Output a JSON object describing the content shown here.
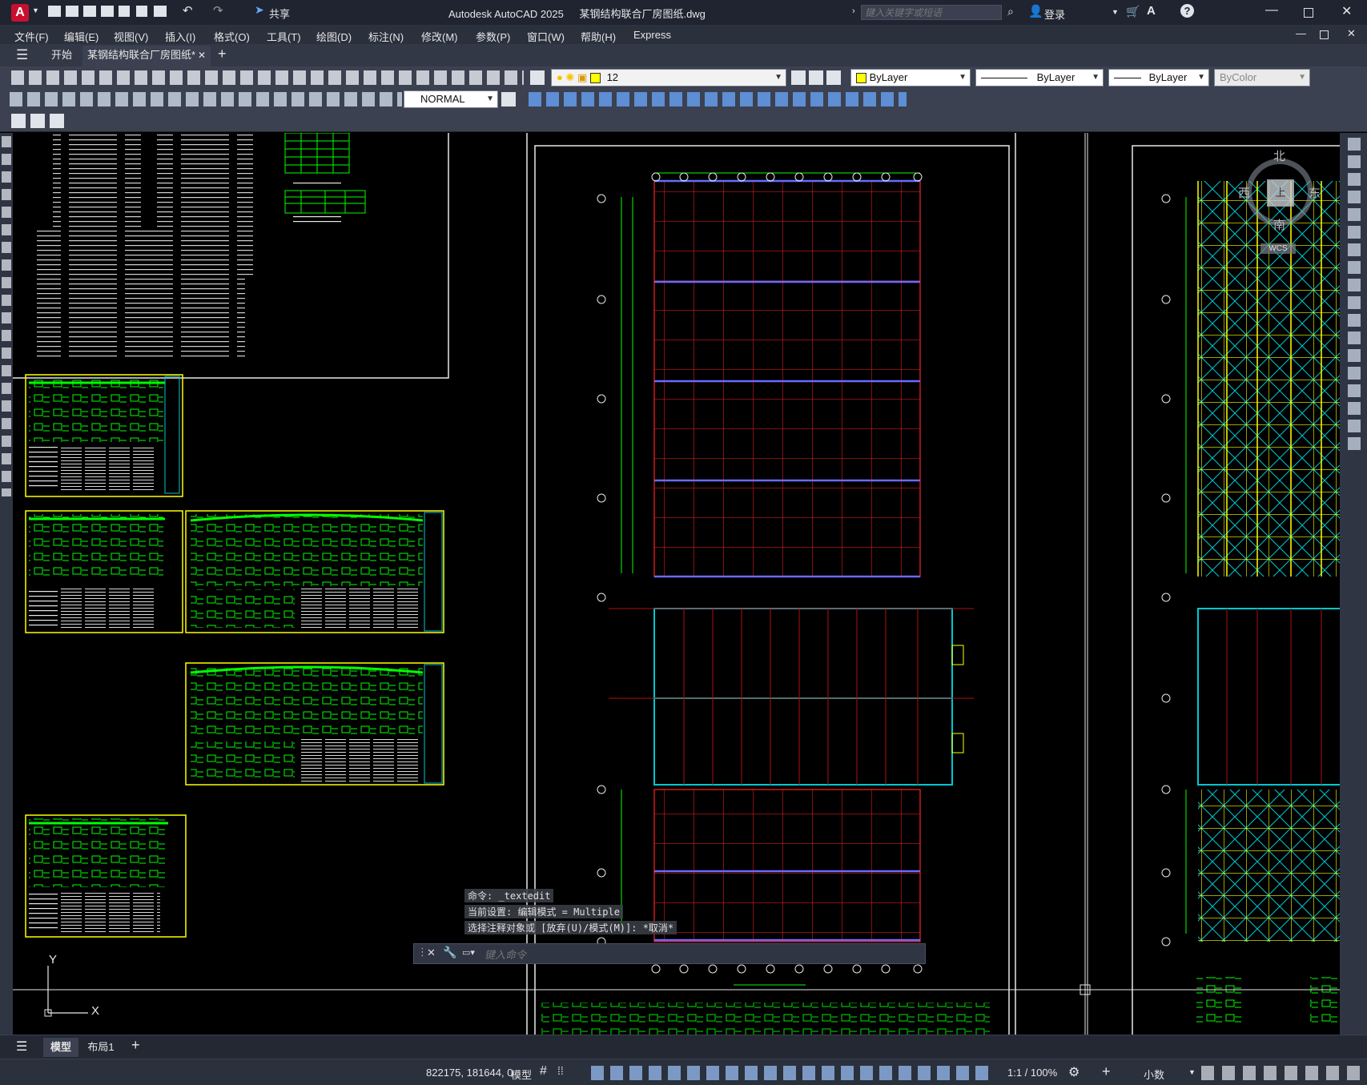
{
  "title_bar": {
    "app_title": "Autodesk AutoCAD 2025",
    "file_name": "某钢结构联合厂房图纸.dwg",
    "share_label": "共享",
    "search_placeholder": "键入关键字或短语",
    "login_label": "登录"
  },
  "menu": {
    "items": [
      "文件(F)",
      "编辑(E)",
      "视图(V)",
      "插入(I)",
      "格式(O)",
      "工具(T)",
      "绘图(D)",
      "标注(N)",
      "修改(M)",
      "参数(P)",
      "窗口(W)",
      "帮助(H)",
      "Express"
    ]
  },
  "doc_tabs": {
    "start_label": "开始",
    "active_label": "某钢结构联合厂房图纸*"
  },
  "toolbar": {
    "layer_value": "12",
    "color_value": "ByLayer",
    "linetype_value": "ByLayer",
    "lineweight_value": "ByLayer",
    "plotstyle_value": "ByColor",
    "style_value": "NORMAL"
  },
  "viewcube": {
    "north": "北",
    "south": "南",
    "west": "西",
    "east": "东",
    "face": "上",
    "wcs": "WCS"
  },
  "ucs": {
    "x_label": "X",
    "y_label": "Y"
  },
  "command": {
    "history": [
      "命令: _textedit",
      "当前设置: 编辑模式 = Multiple",
      "选择注释对象或 [放弃(U)/模式(M)]: *取消*"
    ],
    "placeholder": "键入命令"
  },
  "layout_tabs": {
    "model_label": "模型",
    "layout1_label": "布局1"
  },
  "status": {
    "coordinates": "822175, 181644, 0",
    "space_label": "模型",
    "scale": "1:1 / 100%",
    "units": "小数"
  },
  "colors": {
    "accent": "#c8102e",
    "drawing_red": "#ff2020",
    "drawing_green": "#00ff00",
    "drawing_yellow": "#ffff00",
    "drawing_cyan": "#00c8d0",
    "titlebar_bg": "#1f2430"
  }
}
